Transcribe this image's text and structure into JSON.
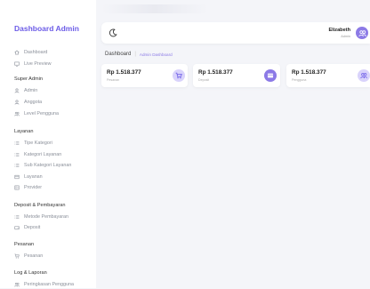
{
  "brand": "Dashboard Admin",
  "sidebar": {
    "top_items": [
      {
        "label": "Dashboard",
        "icon": "home-icon"
      },
      {
        "label": "Live Preview",
        "icon": "monitor-icon"
      }
    ],
    "sections": [
      {
        "title": "Super Admin",
        "items": [
          {
            "label": "Admin",
            "icon": "user-icon"
          },
          {
            "label": "Anggota",
            "icon": "user-icon"
          },
          {
            "label": "Level Pengguna",
            "icon": "users-icon"
          }
        ]
      },
      {
        "title": "Layanan",
        "items": [
          {
            "label": "Tipe Kategori",
            "icon": "list-icon"
          },
          {
            "label": "Kategori Layanan",
            "icon": "list-icon"
          },
          {
            "label": "Sub Kategori Layanan",
            "icon": "list-icon"
          },
          {
            "label": "Layanan",
            "icon": "box-icon"
          },
          {
            "label": "Provider",
            "icon": "server-icon"
          }
        ]
      },
      {
        "title": "Deposit & Pembayaran",
        "items": [
          {
            "label": "Metode Pembayaran",
            "icon": "list-icon"
          },
          {
            "label": "Deposit",
            "icon": "wallet-icon"
          }
        ]
      },
      {
        "title": "Pesanan",
        "items": [
          {
            "label": "Pesanan",
            "icon": "cart-icon"
          }
        ]
      },
      {
        "title": "Log & Laporan",
        "items": [
          {
            "label": "Peringkasan Pengguna",
            "icon": "users-icon"
          }
        ]
      }
    ]
  },
  "topbar": {
    "user_name": "Elizabeth",
    "user_role": "Admin"
  },
  "breadcrumb": {
    "current": "Dashboard",
    "link": "Admin Dashboard"
  },
  "cards": [
    {
      "value": "Rp 1.518.377",
      "sub": "Pesanan",
      "icon": "cart-icon",
      "color": "#8c7ae6"
    },
    {
      "value": "Rp 1.518.377",
      "sub": "Deposit",
      "icon": "wallet-icon",
      "color": "#8c7ae6"
    },
    {
      "value": "Rp 1.518.377",
      "sub": "Pengguna",
      "icon": "users-icon",
      "color": "#8c7ae6"
    }
  ],
  "colors": {
    "accent": "#6c5ce7",
    "accent_soft": "#d9d3fb"
  }
}
